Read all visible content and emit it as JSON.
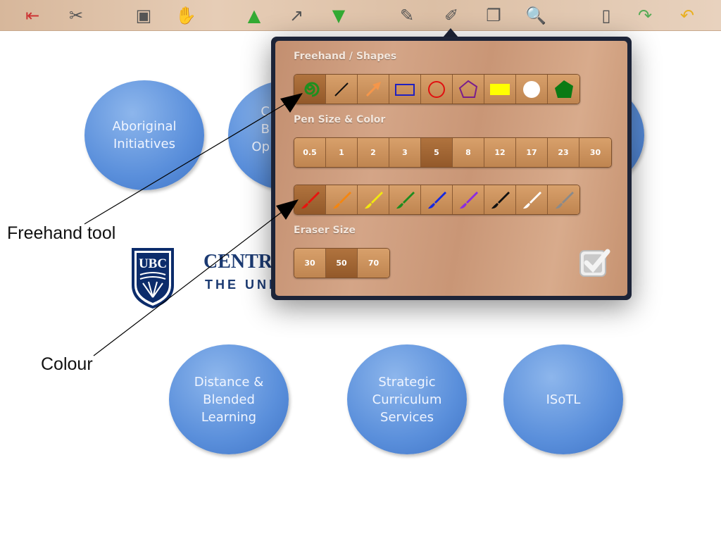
{
  "toolbar": {
    "items": [
      {
        "name": "exit-icon",
        "glyph": "⇤"
      },
      {
        "name": "tools-icon",
        "glyph": "✂"
      },
      {
        "name": "projector-icon",
        "glyph": "▣"
      },
      {
        "name": "stop-icon",
        "glyph": "✋"
      },
      {
        "name": "page-up-icon",
        "glyph": "▲"
      },
      {
        "name": "export-icon",
        "glyph": "↗"
      },
      {
        "name": "page-down-icon",
        "glyph": "▼"
      },
      {
        "name": "pencil-icon",
        "glyph": "✎"
      },
      {
        "name": "draw-settings-icon",
        "glyph": "✐"
      },
      {
        "name": "windows-icon",
        "glyph": "❐"
      },
      {
        "name": "zoom-icon",
        "glyph": "🔍"
      },
      {
        "name": "note-icon",
        "glyph": "▯"
      },
      {
        "name": "redo-icon",
        "glyph": "↷"
      },
      {
        "name": "undo-icon",
        "glyph": "↶"
      }
    ]
  },
  "circles": {
    "c1": "Aboriginal\nInitiatives",
    "c2": "C\nB\nOp",
    "c4": "Distance &\nBlended\nLearning",
    "c5": "Strategic\nCurriculum\nServices",
    "c6": "ISoTL"
  },
  "logo": {
    "shield": "UBC",
    "line1": "CENTRE",
    "line2": "THE UNI"
  },
  "popup": {
    "freehand_title": "Freehand / Shapes",
    "shapes": [
      "freehand",
      "line",
      "arrow",
      "rectangle",
      "circle",
      "polygon",
      "filled-rectangle",
      "filled-circle",
      "filled-polygon"
    ],
    "selected_shape": "freehand",
    "pen_title": "Pen Size & Color",
    "pen_sizes": [
      "0.5",
      "1",
      "2",
      "3",
      "5",
      "8",
      "12",
      "17",
      "23",
      "30"
    ],
    "selected_pen_size": "5",
    "colors": [
      "#e8140f",
      "#f5860f",
      "#f2e810",
      "#1e8c1e",
      "#1428e0",
      "#8a2be2",
      "#111111",
      "#ffffff",
      "#8a8a8a"
    ],
    "selected_color": "#e8140f",
    "eraser_title": "Eraser Size",
    "eraser_sizes": [
      "30",
      "50",
      "70"
    ],
    "selected_eraser": "50"
  },
  "annotations": {
    "freehand": "Freehand tool",
    "colour": "Colour"
  }
}
